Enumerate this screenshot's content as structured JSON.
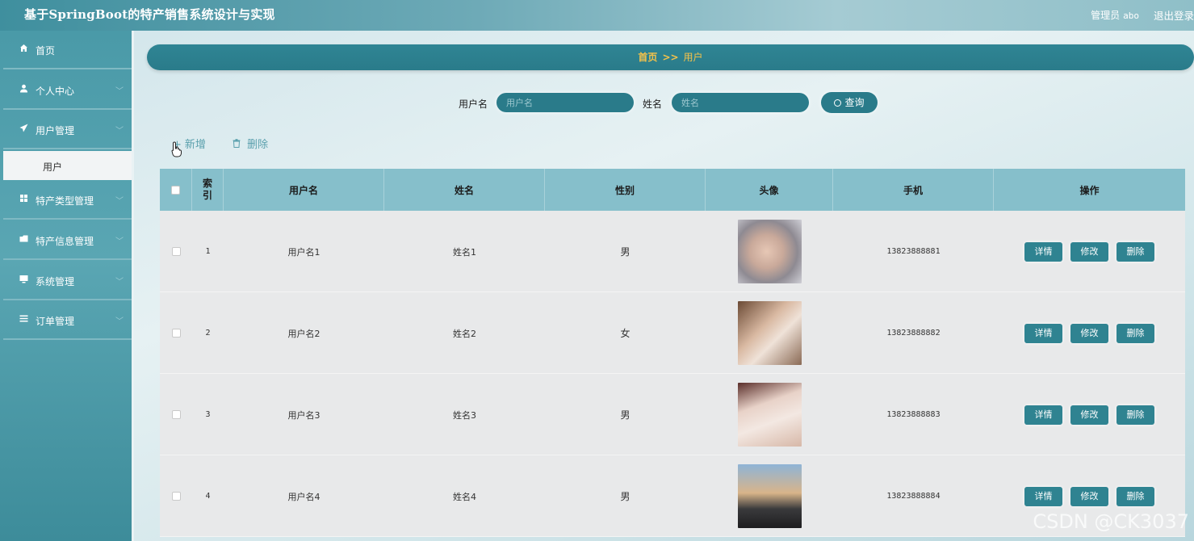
{
  "header": {
    "title": "基于SpringBoot的特产销售系统设计与实现",
    "role_label": "管理员",
    "username": "abo",
    "logout_label": "退出登录"
  },
  "sidebar": {
    "items": [
      {
        "label": "首页",
        "icon": "home-icon"
      },
      {
        "label": "个人中心",
        "icon": "user-icon"
      },
      {
        "label": "用户管理",
        "icon": "send-icon"
      },
      {
        "label": "特产类型管理",
        "icon": "grid-icon"
      },
      {
        "label": "特产信息管理",
        "icon": "folder-icon"
      },
      {
        "label": "系统管理",
        "icon": "monitor-icon"
      },
      {
        "label": "订单管理",
        "icon": "list-icon"
      }
    ],
    "active_sub": "用户"
  },
  "breadcrumb": {
    "home": "首页",
    "separator": ">>",
    "current": "用户"
  },
  "search": {
    "username_label": "用户名",
    "username_placeholder": "用户名",
    "name_label": "姓名",
    "name_placeholder": "姓名",
    "button_label": "查询"
  },
  "actions": {
    "add_label": "新增",
    "delete_label": "删除"
  },
  "table": {
    "headers": {
      "index": "索引",
      "username": "用户名",
      "name": "姓名",
      "gender": "性别",
      "avatar": "头像",
      "phone": "手机",
      "ops": "操作"
    },
    "rows": [
      {
        "index": "1",
        "username": "用户名1",
        "name": "姓名1",
        "gender": "男",
        "phone": "13823888881"
      },
      {
        "index": "2",
        "username": "用户名2",
        "name": "姓名2",
        "gender": "女",
        "phone": "13823888882"
      },
      {
        "index": "3",
        "username": "用户名3",
        "name": "姓名3",
        "gender": "男",
        "phone": "13823888883"
      },
      {
        "index": "4",
        "username": "用户名4",
        "name": "姓名4",
        "gender": "男",
        "phone": "13823888884"
      }
    ],
    "op_labels": {
      "detail": "详情",
      "edit": "修改",
      "delete": "删除"
    }
  },
  "watermark": "CSDN @CK3037",
  "colors": {
    "primary": "#2a7b8a",
    "accent": "#f5c24a",
    "header_row": "#86bfcb"
  }
}
